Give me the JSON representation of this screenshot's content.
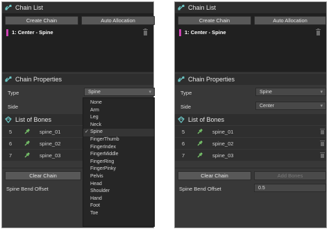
{
  "left": {
    "chain_list": {
      "title": "Chain List",
      "create_label": "Create Chain",
      "auto_label": "Auto Allocation",
      "chain_item": "1: Center - Spine"
    },
    "chain_properties": {
      "title": "Chain Properties",
      "type_label": "Type",
      "type_value": "Spine",
      "side_label": "Side"
    },
    "list_of_bones": {
      "title": "List of Bones",
      "rows": [
        {
          "num": "5",
          "name": "spine_01"
        },
        {
          "num": "6",
          "name": "spine_02"
        },
        {
          "num": "7",
          "name": "spine_03"
        }
      ]
    },
    "clear_label": "Clear Chain",
    "bend_label": "Spine Bend Offset",
    "dropdown": {
      "selected": "Spine",
      "options": [
        "None",
        "Arm",
        "Leg",
        "Neck",
        "Spine",
        "FingerThumb",
        "FingerIndex",
        "FingerMiddle",
        "FingerRing",
        "FingerPinky",
        "Pelvis",
        "Head",
        "Shoulder",
        "Hand",
        "Foot",
        "Toe"
      ]
    }
  },
  "right": {
    "chain_list": {
      "title": "Chain List",
      "create_label": "Create Chain",
      "auto_label": "Auto Allocation",
      "chain_item": "1: Center - Spine"
    },
    "chain_properties": {
      "title": "Chain Properties",
      "type_label": "Type",
      "type_value": "Spine",
      "side_label": "Side",
      "side_value": "Center"
    },
    "list_of_bones": {
      "title": "List of Bones",
      "rows": [
        {
          "num": "5",
          "name": "spine_01"
        },
        {
          "num": "6",
          "name": "spine_02"
        },
        {
          "num": "7",
          "name": "spine_03"
        }
      ]
    },
    "clear_label": "Clear Chain",
    "add_label": "Add Bones",
    "bend_label": "Spine Bend Offset",
    "bend_value": "0.5"
  },
  "icons": {
    "chain": "chain-link-icon",
    "bones": "diamond-bone-icon",
    "pin": "pin-icon",
    "trash": "trash-icon",
    "dropdown": "chevron-down-icon",
    "check": "check-icon"
  },
  "colors": {
    "chain_accent": "#d043b5",
    "header_icon": "#6cc7c6",
    "pin": "#77c36a"
  }
}
